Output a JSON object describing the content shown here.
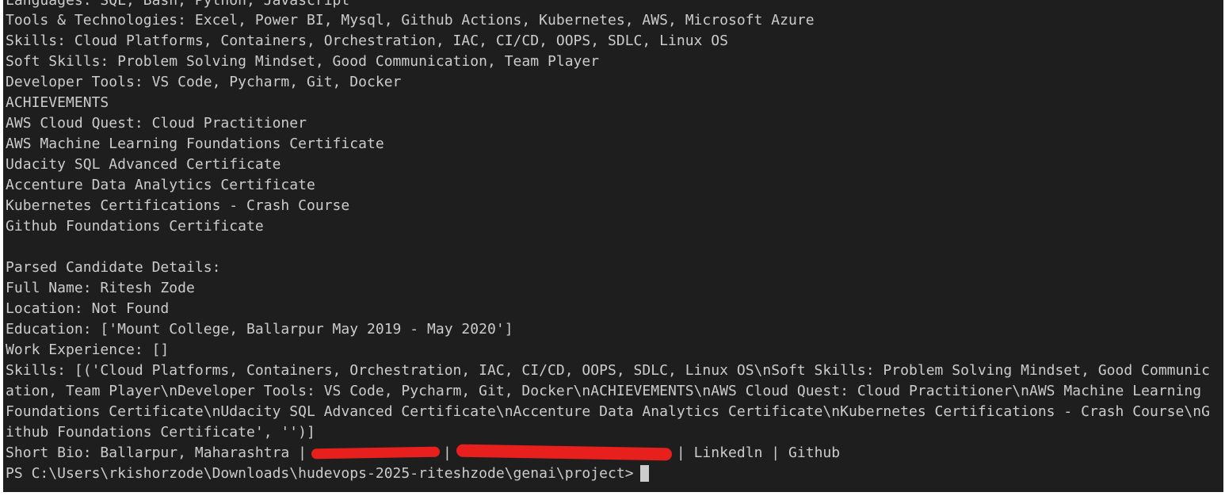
{
  "terminal": {
    "lines": [
      "Languages: SQL, Bash, Python, Javascript",
      "Tools & Technologies: Excel, Power BI, Mysql, Github Actions, Kubernetes, AWS, Microsoft Azure",
      "Skills: Cloud Platforms, Containers, Orchestration, IAC, CI/CD, OOPS, SDLC, Linux OS",
      "Soft Skills: Problem Solving Mindset, Good Communication, Team Player",
      "Developer Tools: VS Code, Pycharm, Git, Docker",
      "ACHIEVEMENTS",
      "AWS Cloud Quest: Cloud Practitioner",
      "AWS Machine Learning Foundations Certificate",
      "Udacity SQL Advanced Certificate",
      "Accenture Data Analytics Certificate",
      "Kubernetes Certifications - Crash Course",
      "Github Foundations Certificate",
      "",
      "Parsed Candidate Details:",
      "Full Name: Ritesh Zode",
      "Location: Not Found",
      "Education: ['Mount College, Ballarpur May 2019 - May 2020']",
      "Work Experience: []",
      "Skills: [('Cloud Platforms, Containers, Orchestration, IAC, CI/CD, OOPS, SDLC, Linux OS\\nSoft Skills: Problem Solving Mindset, Good Communic",
      "ation, Team Player\\nDeveloper Tools: VS Code, Pycharm, Git, Docker\\nACHIEVEMENTS\\nAWS Cloud Quest: Cloud Practitioner\\nAWS Machine Learning",
      "Foundations Certificate\\nUdacity SQL Advanced Certificate\\nAccenture Data Analytics Certificate\\nKubernetes Certifications - Crash Course\\nG",
      "ithub Foundations Certificate', '')]"
    ],
    "bio": {
      "prefix": "Short Bio: Ballarpur, Maharashtra |",
      "sep": "|",
      "suffix": "| Linkedln | Github"
    },
    "prompt": "PS C:\\Users\\rkishorzode\\Downloads\\hudevops-2025-riteshzode\\genai\\project>",
    "colors": {
      "background": "#1e1e1e",
      "text": "#cccccc",
      "redaction": "#e8201d"
    }
  }
}
